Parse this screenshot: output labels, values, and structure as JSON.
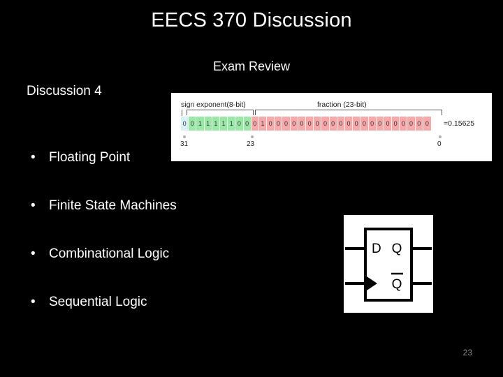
{
  "slide": {
    "title": "EECS 370 Discussion",
    "subtitle": "Exam Review",
    "section_label": "Discussion 4",
    "page_number": "23",
    "background_color": "#000000",
    "text_color": "#ffffff",
    "page_number_color": "#8c8c8c"
  },
  "bullets": [
    {
      "marker": "•",
      "label": "Floating Point"
    },
    {
      "marker": "•",
      "label": "Finite State Machines"
    },
    {
      "marker": "•",
      "label": "Combinational Logic"
    },
    {
      "marker": "•",
      "label": "Sequential Logic"
    }
  ],
  "floating_point_figure": {
    "caption_sign_exponent": "sign exponent(8-bit)",
    "caption_fraction": "fraction (23-bit)",
    "value_label": "=0.15625",
    "sign_bits": "0",
    "exponent_bits": "01111100",
    "fraction_bits": "01000000000000000000000",
    "tick_labels": [
      "31",
      "23",
      "0"
    ],
    "colors": {
      "sign": "#d9f2f7",
      "exponent": "#9ae8a6",
      "fraction": "#f7a8a8",
      "panel": "#ffffff",
      "text": "#1c1c1c"
    }
  },
  "flipflop_figure": {
    "input_label": "D",
    "output_label": "Q",
    "inverted_output_label": "Q",
    "clock_marker": "triangle",
    "colors": {
      "panel": "#ffffff",
      "stroke": "#000000"
    }
  }
}
